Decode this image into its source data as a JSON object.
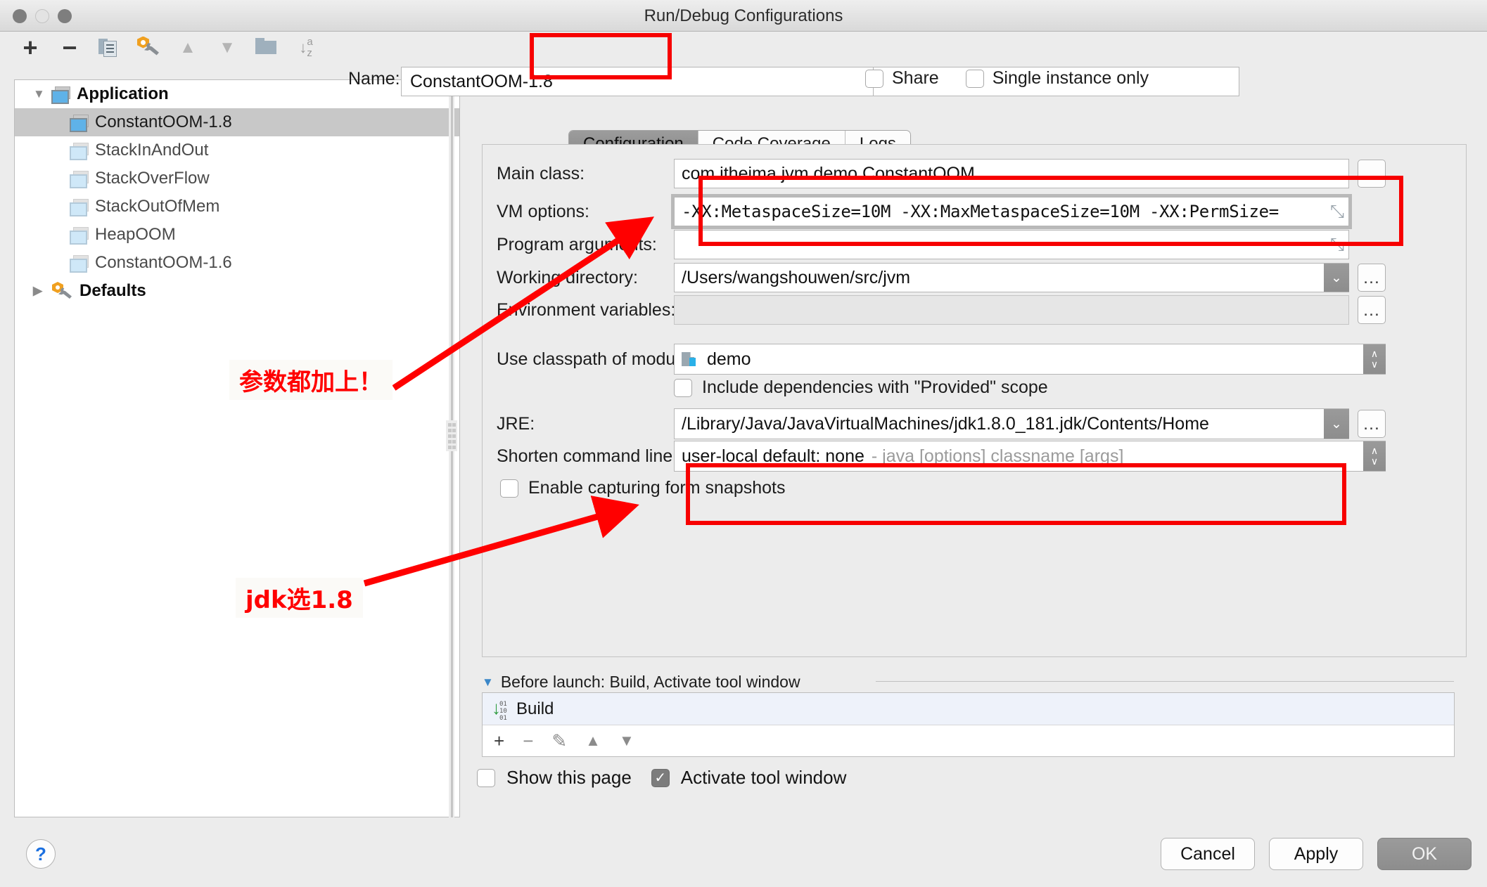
{
  "window": {
    "title": "Run/Debug Configurations",
    "traffic_lights": [
      "close",
      "minimize",
      "zoom"
    ]
  },
  "toolbar": {
    "icons": [
      {
        "name": "add-icon",
        "glyph": "+"
      },
      {
        "name": "remove-icon",
        "glyph": "−"
      },
      {
        "name": "copy-configuration-icon",
        "glyph": "❐"
      },
      {
        "name": "edit-defaults-icon",
        "glyph": "⚙"
      },
      {
        "name": "move-up-icon",
        "glyph": "▲"
      },
      {
        "name": "move-down-icon",
        "glyph": "▼"
      },
      {
        "name": "folder-icon",
        "glyph": "▰"
      },
      {
        "name": "sort-alphabetically-icon",
        "glyph": "↓a↓z"
      }
    ]
  },
  "tree": {
    "nodes": [
      {
        "label": "Application",
        "type": "root",
        "expanded": true,
        "twisty": "▼",
        "icon": "application-icon"
      },
      {
        "label": "ConstantOOM-1.8",
        "type": "child",
        "selected": true,
        "icon": "application-icon"
      },
      {
        "label": "StackInAndOut",
        "type": "child",
        "selected": false,
        "icon": "application-icon"
      },
      {
        "label": "StackOverFlow",
        "type": "child",
        "selected": false,
        "icon": "application-icon"
      },
      {
        "label": "StackOutOfMem",
        "type": "child",
        "selected": false,
        "icon": "application-icon"
      },
      {
        "label": "HeapOOM",
        "type": "child",
        "selected": false,
        "icon": "application-icon"
      },
      {
        "label": "ConstantOOM-1.6",
        "type": "child",
        "selected": false,
        "icon": "application-icon"
      },
      {
        "label": "Defaults",
        "type": "root",
        "expanded": false,
        "twisty": "▶",
        "icon": "defaults-wrench-icon"
      }
    ]
  },
  "header": {
    "name_label": "Name:",
    "name_value": "ConstantOOM-1.8",
    "share_label": "Share",
    "share_checked": false,
    "single_instance_label": "Single instance only",
    "single_instance_checked": false
  },
  "tabs": [
    {
      "label": "Configuration",
      "active": true
    },
    {
      "label": "Code Coverage",
      "active": false
    },
    {
      "label": "Logs",
      "active": false
    }
  ],
  "form": {
    "main_class": {
      "label": "Main class:",
      "value": "com.itheima.jvm.demo.ConstantOOM",
      "browse": "…"
    },
    "vm_options": {
      "label": "VM options:",
      "value": "-XX:MetaspaceSize=10M -XX:MaxMetaspaceSize=10M -XX:PermSize=",
      "expand": "⤡"
    },
    "program_arguments": {
      "label": "Program arguments:",
      "value": "",
      "expand": "⤡"
    },
    "working_directory": {
      "label": "Working directory:",
      "value": "/Users/wangshouwen/src/jvm",
      "browse": "…",
      "arrow": "⌄"
    },
    "environment_variables": {
      "label": "Environment variables:",
      "value": "",
      "browse": "…"
    },
    "use_classpath_of_module": {
      "label": "Use classpath of module:",
      "value": "demo",
      "stepper_up": "∧",
      "stepper_down": "∨"
    },
    "include_provided": {
      "label": "Include dependencies with \"Provided\" scope",
      "checked": false
    },
    "jre": {
      "label": "JRE:",
      "value": "/Library/Java/JavaVirtualMachines/jdk1.8.0_181.jdk/Contents/Home",
      "browse": "…",
      "arrow": "⌄"
    },
    "shorten_command_line": {
      "label": "Shorten command line:",
      "value": "user-local default: none",
      "hint": "- java [options] classname [args]",
      "stepper_up": "∧",
      "stepper_down": "∨"
    },
    "enable_form_snapshots": {
      "label": "Enable capturing form snapshots",
      "checked": false
    }
  },
  "before_launch": {
    "header": "Before launch: Build, Activate tool window",
    "twisty": "▼",
    "items": [
      {
        "label": "Build",
        "icon": "build-binary-icon"
      }
    ],
    "tools": [
      {
        "name": "add-task-icon",
        "glyph": "+",
        "enabled": true
      },
      {
        "name": "remove-task-icon",
        "glyph": "−",
        "enabled": false
      },
      {
        "name": "edit-task-icon",
        "glyph": "✎",
        "enabled": false
      },
      {
        "name": "move-task-up-icon",
        "glyph": "▲",
        "enabled": false
      },
      {
        "name": "move-task-down-icon",
        "glyph": "▼",
        "enabled": false
      }
    ],
    "show_this_page": {
      "label": "Show this page",
      "checked": false
    },
    "activate_tool_window": {
      "label": "Activate tool window",
      "checked": true,
      "check_glyph": "✓"
    }
  },
  "footer": {
    "help_glyph": "?",
    "cancel": "Cancel",
    "apply": "Apply",
    "ok": "OK"
  },
  "annotations": {
    "accent_color": "#ff0000",
    "notes": [
      {
        "text": "参数都加上！",
        "target": "vm-options-field"
      },
      {
        "text": "jdk选1.8",
        "target": "jre-field"
      }
    ]
  }
}
